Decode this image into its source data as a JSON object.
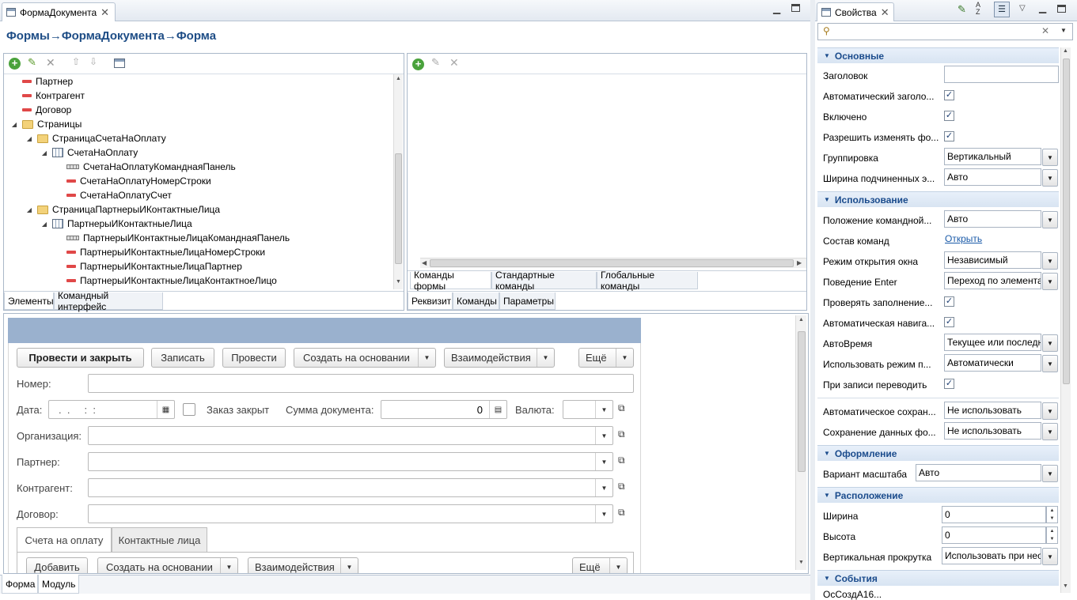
{
  "editor": {
    "tab_title": "ФормаДокумента",
    "breadcrumb": "Формы→ФормаДокумента→Форма"
  },
  "elements_tree": {
    "rows": [
      {
        "label": "Партнер",
        "icon": "field-icon",
        "level": 1,
        "expander": ""
      },
      {
        "label": "Контрагент",
        "icon": "field-icon",
        "level": 1,
        "expander": ""
      },
      {
        "label": "Договор",
        "icon": "field-icon",
        "level": 1,
        "expander": ""
      },
      {
        "label": "Страницы",
        "icon": "folder-icon",
        "level": 0,
        "expander": "◢"
      },
      {
        "label": "СтраницаСчетаНаОплату",
        "icon": "folder-icon",
        "level": 1,
        "expander": "◢"
      },
      {
        "label": "СчетаНаОплату",
        "icon": "table-icon",
        "level": 2,
        "expander": "◢"
      },
      {
        "label": "СчетаНаОплатуКоманднаяПанель",
        "icon": "command-bar-icon",
        "level": 3,
        "expander": ""
      },
      {
        "label": "СчетаНаОплатуНомерСтроки",
        "icon": "field-icon",
        "level": 3,
        "expander": ""
      },
      {
        "label": "СчетаНаОплатуСчет",
        "icon": "field-icon",
        "level": 3,
        "expander": ""
      },
      {
        "label": "СтраницаПартнерыИКонтактныеЛица",
        "icon": "folder-icon",
        "level": 1,
        "expander": "◢"
      },
      {
        "label": "ПартнерыИКонтактныеЛица",
        "icon": "table-icon",
        "level": 2,
        "expander": "◢"
      },
      {
        "label": "ПартнерыИКонтактныеЛицаКоманднаяПанель",
        "icon": "command-bar-icon",
        "level": 3,
        "expander": ""
      },
      {
        "label": "ПартнерыИКонтактныеЛицаНомерСтроки",
        "icon": "field-icon",
        "level": 3,
        "expander": ""
      },
      {
        "label": "ПартнерыИКонтактныеЛицаПартнер",
        "icon": "field-icon",
        "level": 3,
        "expander": ""
      },
      {
        "label": "ПартнерыИКонтактныеЛицаКонтактноеЛицо",
        "icon": "field-icon",
        "level": 3,
        "expander": ""
      }
    ],
    "tab_elements": "Элементы",
    "tab_command_interface": "Командный интерфейс"
  },
  "commands_panel": {
    "tab_form_commands": "Команды формы",
    "tab_standard_commands": "Стандартные команды",
    "tab_global_commands": "Глобальные команды",
    "tab_attributes": "Реквизит",
    "tab_commands": "Команды",
    "tab_parameters": "Параметры"
  },
  "preview": {
    "buttons": {
      "post_close": "Провести и закрыть",
      "save": "Записать",
      "post": "Провести",
      "create_based": "Создать на основании",
      "interactions": "Взаимодействия",
      "more": "Ещё"
    },
    "labels": {
      "number": "Номер:",
      "date": "Дата:",
      "order_closed": "Заказ закрыт",
      "doc_sum": "Сумма документа:",
      "currency": "Валюта:",
      "organization": "Организация:",
      "partner": "Партнер:",
      "counterparty": "Контрагент:",
      "contract": "Договор:"
    },
    "date_placeholder": ".  .     :  :",
    "sum_value": "0",
    "tabs": {
      "invoices": "Счета на оплату",
      "contacts": "Контактные лица"
    },
    "table_buttons": {
      "add": "Добавить",
      "create_based": "Создать на основании",
      "interactions": "Взаимодействия",
      "more": "Ещё"
    }
  },
  "bottom_tabs": {
    "form": "Форма",
    "module": "Модуль"
  },
  "properties": {
    "title": "Свойства",
    "sections": {
      "main": "Основные",
      "usage": "Использование",
      "appearance": "Оформление",
      "layout": "Расположение",
      "events": "События"
    },
    "rows": {
      "header": "Заголовок",
      "auto_header": "Автоматический заголо...",
      "enabled": "Включено",
      "allow_change": "Разрешить изменять фо...",
      "grouping": "Группировка",
      "grouping_val": "Вертикальный",
      "child_width": "Ширина подчиненных э...",
      "child_width_val": "Авто",
      "cmdbar_position": "Положение командной...",
      "cmdbar_position_val": "Авто",
      "cmd_composition": "Состав команд",
      "cmd_composition_val": "Открыть",
      "open_mode": "Режим открытия окна",
      "open_mode_val": "Независимый",
      "enter_behavior": "Поведение Enter",
      "enter_behavior_val": "Переход по элемента",
      "check_filling": "Проверять заполнение...",
      "auto_navigation": "Автоматическая навига...",
      "autotime": "АвтоВремя",
      "autotime_val": "Текущее или последн",
      "use_mode": "Использовать режим п...",
      "use_mode_val": "Автоматически",
      "on_write": "При записи переводить",
      "auto_save": "Автоматическое сохран...",
      "auto_save_val": "Не использовать",
      "save_data": "Сохранение данных фо...",
      "save_data_val": "Не использовать",
      "scale_variant": "Вариант масштаба",
      "scale_variant_val": "Авто",
      "width": "Ширина",
      "width_val": "0",
      "height": "Высота",
      "height_val": "0",
      "v_scroll": "Вертикальная прокрутка",
      "v_scroll_val": "Использовать при нео"
    },
    "partial_row": "ОсСоздА16..."
  },
  "colors": {
    "section_title": "#1a4b8c",
    "link": "#1a5aa8",
    "form_header_bar": "#9ab1ce"
  }
}
